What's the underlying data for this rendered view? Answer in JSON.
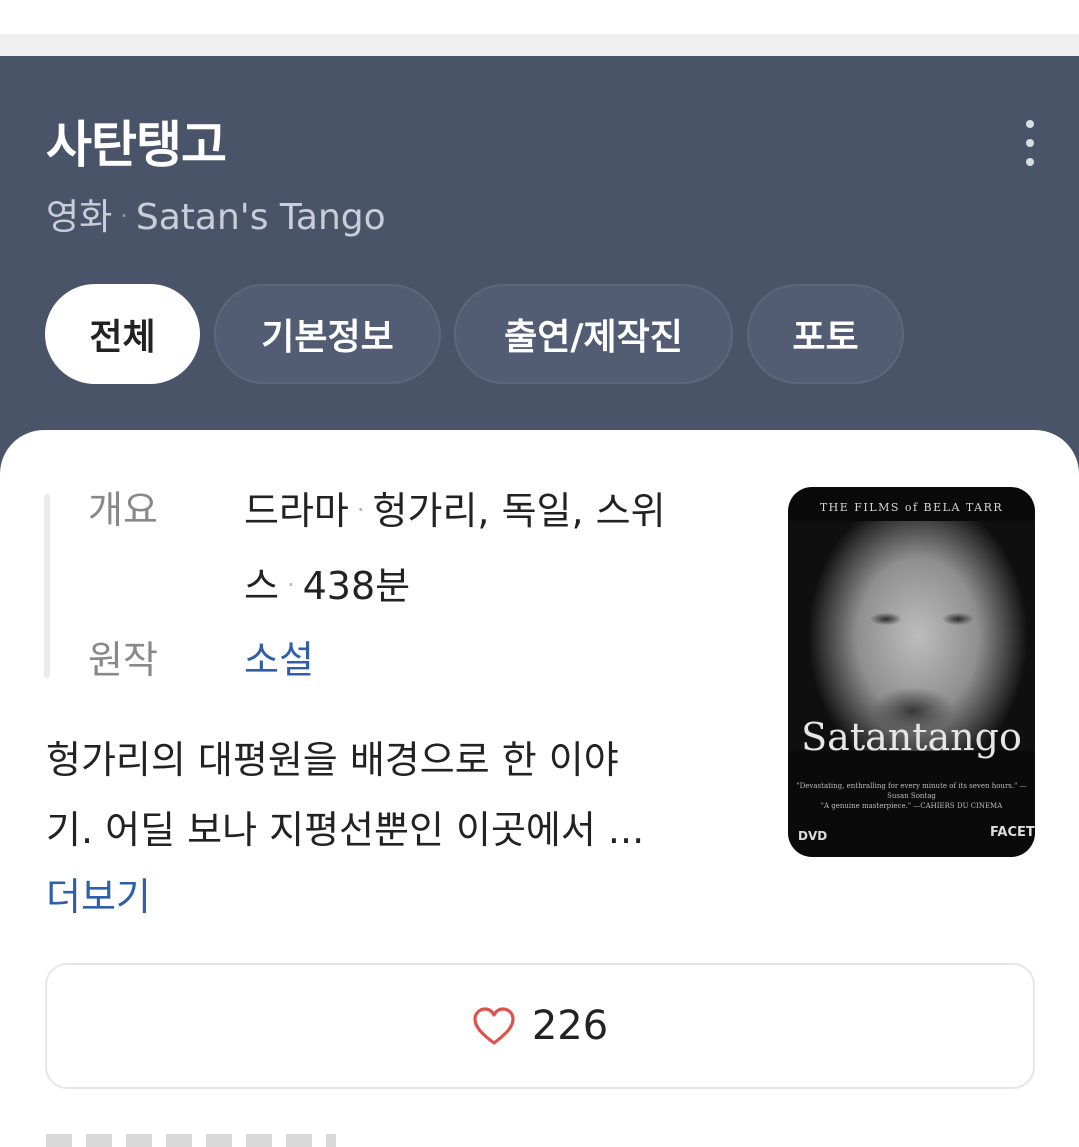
{
  "header": {
    "title": "사탄탱고",
    "category": "영화",
    "separator": "·",
    "original_title": "Satan's Tango",
    "menu_icon": "more-vertical-icon",
    "background_color": "#4a5469"
  },
  "tabs": [
    {
      "label": "전체",
      "active": true
    },
    {
      "label": "기본정보",
      "active": false
    },
    {
      "label": "출연/제작진",
      "active": false
    },
    {
      "label": "포토",
      "active": false
    }
  ],
  "info": {
    "overview_label": "개요",
    "genre": "드라마",
    "countries_line1": "헝가리, 독일, 스위",
    "countries_line2": "스",
    "runtime": "438분",
    "origin_label": "원작",
    "origin_value": "소설",
    "link_color": "#2f5fa8"
  },
  "synopsis": {
    "line1": "헝가리의 대평원을 배경으로 한 이야",
    "line2": "기. 어딜 보나 지평선뿐인 이곳에서 ...",
    "more_label": "더보기"
  },
  "poster": {
    "top_text": "THE FILMS of BELA TARR",
    "logo_text": "Satantango",
    "quote1": "\"Devastating, enthralling for every minute of its seven hours.\" —Susan Sontag",
    "quote2": "\"A genuine masterpiece.\" —CAHIERS DU CINEMA",
    "dvd_label": "DVD",
    "publisher": "FACETS"
  },
  "like": {
    "icon": "heart-outline-icon",
    "count": "226",
    "icon_color": "#e0514b"
  }
}
